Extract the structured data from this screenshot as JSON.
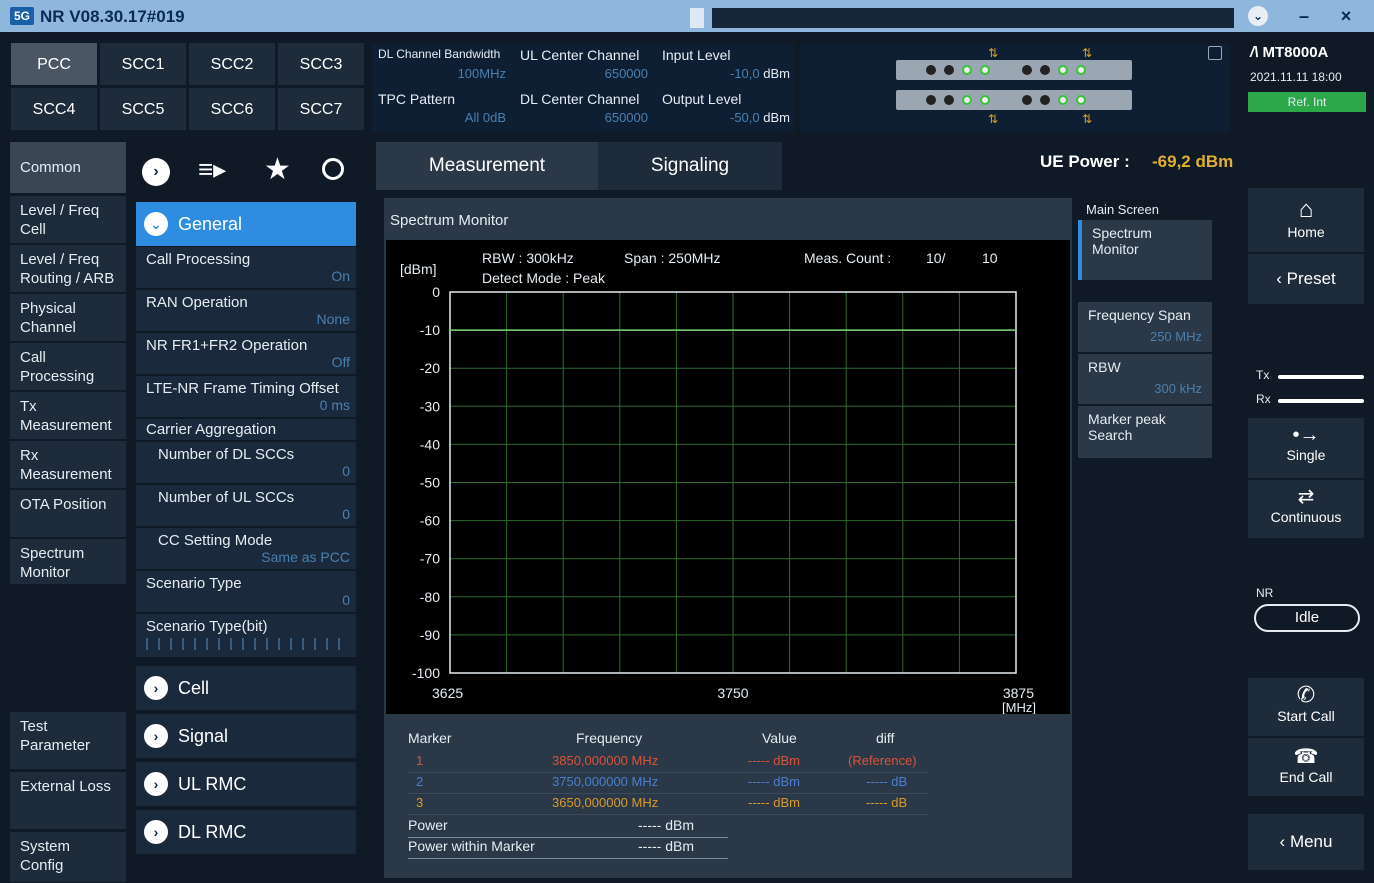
{
  "window": {
    "title": "NR V08.30.17#019",
    "logo": "5G"
  },
  "cc_tabs": [
    "PCC",
    "SCC1",
    "SCC2",
    "SCC3",
    "SCC4",
    "SCC5",
    "SCC6",
    "SCC7"
  ],
  "params": {
    "dl_bw_label": "DL Channel Bandwidth",
    "dl_bw_value": "100MHz",
    "ul_cc_label": "UL Center Channel",
    "ul_cc_value": "650000",
    "in_lvl_label": "Input Level",
    "in_lvl_value": "-10,0",
    "in_lvl_unit": "dBm",
    "tpc_label": "TPC Pattern",
    "tpc_value": "All 0dB",
    "dl_cc_label": "DL Center Channel",
    "dl_cc_value": "650000",
    "out_lvl_label": "Output Level",
    "out_lvl_value": "-50,0",
    "out_lvl_unit": "dBm"
  },
  "instrument": {
    "model": "MT8000A",
    "datetime": "2021.11.11 18:00",
    "ref": "Ref. Int"
  },
  "nav": {
    "common": "Common",
    "items": [
      "Level / Freq Cell",
      "Level / Freq Routing / ARB",
      "Physical Channel",
      "Call Processing",
      "Tx Measurement",
      "Rx Measurement",
      "OTA Position",
      "Spectrum Monitor"
    ],
    "bottom": [
      "Test Parameter",
      "External Loss",
      "System Config"
    ]
  },
  "general": {
    "title": "General",
    "items": [
      {
        "label": "Call Processing",
        "value": "On"
      },
      {
        "label": "RAN Operation",
        "value": "None"
      },
      {
        "label": "NR FR1+FR2 Operation",
        "value": "Off"
      },
      {
        "label": "LTE-NR Frame Timing Offset",
        "value": "0 ms"
      }
    ],
    "carrier_agg": "Carrier Aggregation",
    "ca_items": [
      {
        "label": "Number of DL SCCs",
        "value": "0"
      },
      {
        "label": "Number of UL SCCs",
        "value": "0"
      },
      {
        "label": "CC Setting Mode",
        "value": "Same as PCC"
      }
    ],
    "scenario_type": {
      "label": "Scenario Type",
      "value": "0"
    },
    "scenario_bits": {
      "label": "Scenario Type(bit)"
    }
  },
  "sections": [
    "Cell",
    "Signal",
    "UL RMC",
    "DL RMC"
  ],
  "tabs": {
    "measurement": "Measurement",
    "signaling": "Signaling"
  },
  "ue_power": {
    "label": "UE Power :",
    "value": "-69,2 dBm"
  },
  "spectrum": {
    "title": "Spectrum Monitor",
    "rbw": "RBW : 300kHz",
    "span": "Span : 250MHz",
    "detect": "Detect Mode : Peak",
    "meas_count_label": "Meas. Count :",
    "meas_count": "10/",
    "meas_total": "10"
  },
  "chart_data": {
    "type": "line",
    "ylabel": "[dBm]",
    "xlabel": "[MHz]",
    "ylim": [
      -100,
      0
    ],
    "xlim": [
      3625,
      3875
    ],
    "yticks": [
      "0",
      "-10",
      "-20",
      "-30",
      "-40",
      "-50",
      "-60",
      "-70",
      "-80",
      "-90",
      "-100"
    ],
    "xticks": [
      "3625",
      "3750",
      "3875"
    ],
    "series": [
      {
        "values": [
          [
            3625,
            -10
          ],
          [
            3875,
            -10
          ]
        ],
        "color": "#7cd67c"
      }
    ],
    "grid": true
  },
  "markers": {
    "headers": [
      "Marker",
      "Frequency",
      "Value",
      "diff"
    ],
    "rows": [
      {
        "id": "1",
        "freq": "3850,000000 MHz",
        "value": "----- dBm",
        "diff": "(Reference)",
        "color": "#d9533b"
      },
      {
        "id": "2",
        "freq": "3750,000000 MHz",
        "value": "----- dBm",
        "diff": "----- dB",
        "color": "#4a7fd0"
      },
      {
        "id": "3",
        "freq": "3650,000000 MHz",
        "value": "----- dBm",
        "diff": "----- dB",
        "color": "#d89a2a"
      }
    ],
    "power_label": "Power",
    "power_value": "----- dBm",
    "pwm_label": "Power within Marker",
    "pwm_value": "----- dBm"
  },
  "right_panel": {
    "main_screen": "Main Screen",
    "spectrum_monitor": "Spectrum Monitor",
    "freq_span_label": "Frequency Span",
    "freq_span_value": "250 MHz",
    "rbw_label": "RBW",
    "rbw_value": "300 kHz",
    "marker_peak": "Marker peak Search"
  },
  "sidebar": {
    "home": "Home",
    "preset": "Preset",
    "tx": "Tx",
    "rx": "Rx",
    "single": "Single",
    "continuous": "Continuous",
    "nr_label": "NR",
    "nr_state": "Idle",
    "start_call": "Start Call",
    "end_call": "End Call",
    "menu": "Menu"
  }
}
